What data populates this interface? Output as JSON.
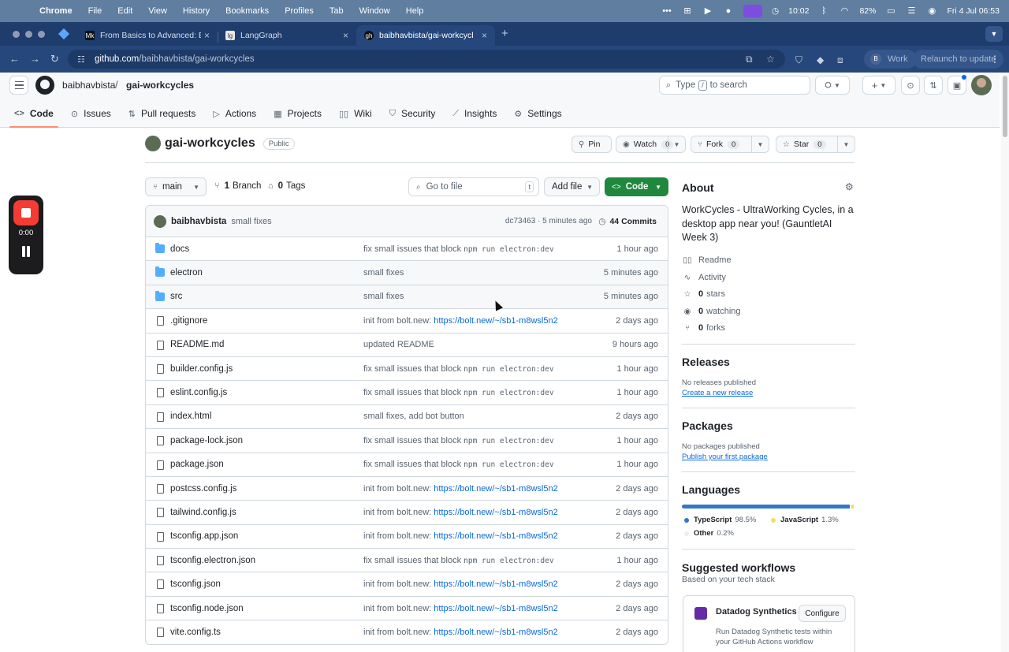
{
  "menubar": {
    "app": "Chrome",
    "items": [
      "File",
      "Edit",
      "View",
      "History",
      "Bookmarks",
      "Profiles",
      "Tab",
      "Window",
      "Help"
    ],
    "clock_timer": "10:02",
    "battery": "82%",
    "datetime": "Fri 4 Jul  06:53"
  },
  "browser": {
    "tabs": [
      {
        "title": "From Basics to Advanced: Ex",
        "favicon": "Mk"
      },
      {
        "title": "LangGraph",
        "favicon": "lg"
      },
      {
        "title": "baibhavbista/gai-workcycles",
        "favicon": "gh"
      }
    ],
    "url_host": "github.com",
    "url_path": "/baibhavbista/gai-workcycles",
    "profile_initial": "B",
    "profile_label": "Work",
    "relaunch_label": "Relaunch to update"
  },
  "header": {
    "owner": "baibhavbista",
    "separator": "/",
    "repo": "gai-workcycles",
    "search_prefix": "Type",
    "search_key": "/",
    "search_suffix": "to search"
  },
  "repo_nav": [
    {
      "label": "Code",
      "icon": "code-icon"
    },
    {
      "label": "Issues",
      "icon": "issue-icon"
    },
    {
      "label": "Pull requests",
      "icon": "pull-request-icon"
    },
    {
      "label": "Actions",
      "icon": "play-icon"
    },
    {
      "label": "Projects",
      "icon": "table-icon"
    },
    {
      "label": "Wiki",
      "icon": "book-icon"
    },
    {
      "label": "Security",
      "icon": "shield-icon"
    },
    {
      "label": "Insights",
      "icon": "graph-icon"
    },
    {
      "label": "Settings",
      "icon": "gear-icon"
    }
  ],
  "recorder": {
    "time": "0:00"
  },
  "repo": {
    "name": "gai-workcycles",
    "visibility": "Public",
    "pin_label": "Pin",
    "watch_label": "Watch",
    "watch_count": "0",
    "fork_label": "Fork",
    "fork_count": "0",
    "star_label": "Star",
    "star_count": "0"
  },
  "branch_bar": {
    "branch": "main",
    "branch_count": "1",
    "branch_word": "Branch",
    "tag_count": "0",
    "tag_word": "Tags",
    "goto_placeholder": "Go to file",
    "goto_key": "t",
    "add_file_label": "Add file",
    "code_label": "Code"
  },
  "latest_commit": {
    "author": "baibhavbista",
    "message": "small fixes",
    "hash_time": "dc73463 · 5 minutes ago",
    "commits_label": "44 Commits"
  },
  "files": [
    {
      "name": "docs",
      "type": "dir",
      "msg": "fix small issues that block ",
      "code": "npm run electron:dev",
      "link": "",
      "age": "1 hour ago"
    },
    {
      "name": "electron",
      "type": "dir",
      "msg": "small fixes",
      "code": "",
      "link": "",
      "age": "5 minutes ago"
    },
    {
      "name": "src",
      "type": "dir",
      "msg": "small fixes",
      "code": "",
      "link": "",
      "age": "5 minutes ago"
    },
    {
      "name": ".gitignore",
      "type": "file",
      "msg": "init from bolt.new: ",
      "code": "",
      "link": "https://bolt.new/~/sb1-m8wsl5n2",
      "age": "2 days ago"
    },
    {
      "name": "README.md",
      "type": "file",
      "msg": "updated README",
      "code": "",
      "link": "",
      "age": "9 hours ago"
    },
    {
      "name": "builder.config.js",
      "type": "file",
      "msg": "fix small issues that block ",
      "code": "npm run electron:dev",
      "link": "",
      "age": "1 hour ago"
    },
    {
      "name": "eslint.config.js",
      "type": "file",
      "msg": "fix small issues that block ",
      "code": "npm run electron:dev",
      "link": "",
      "age": "1 hour ago"
    },
    {
      "name": "index.html",
      "type": "file",
      "msg": "small fixes, add bot button",
      "code": "",
      "link": "",
      "age": "2 days ago"
    },
    {
      "name": "package-lock.json",
      "type": "file",
      "msg": "fix small issues that block ",
      "code": "npm run electron:dev",
      "link": "",
      "age": "1 hour ago"
    },
    {
      "name": "package.json",
      "type": "file",
      "msg": "fix small issues that block ",
      "code": "npm run electron:dev",
      "link": "",
      "age": "1 hour ago"
    },
    {
      "name": "postcss.config.js",
      "type": "file",
      "msg": "init from bolt.new: ",
      "code": "",
      "link": "https://bolt.new/~/sb1-m8wsl5n2",
      "age": "2 days ago"
    },
    {
      "name": "tailwind.config.js",
      "type": "file",
      "msg": "init from bolt.new: ",
      "code": "",
      "link": "https://bolt.new/~/sb1-m8wsl5n2",
      "age": "2 days ago"
    },
    {
      "name": "tsconfig.app.json",
      "type": "file",
      "msg": "init from bolt.new: ",
      "code": "",
      "link": "https://bolt.new/~/sb1-m8wsl5n2",
      "age": "2 days ago"
    },
    {
      "name": "tsconfig.electron.json",
      "type": "file",
      "msg": "fix small issues that block ",
      "code": "npm run electron:dev",
      "link": "",
      "age": "1 hour ago"
    },
    {
      "name": "tsconfig.json",
      "type": "file",
      "msg": "init from bolt.new: ",
      "code": "",
      "link": "https://bolt.new/~/sb1-m8wsl5n2",
      "age": "2 days ago"
    },
    {
      "name": "tsconfig.node.json",
      "type": "file",
      "msg": "init from bolt.new: ",
      "code": "",
      "link": "https://bolt.new/~/sb1-m8wsl5n2",
      "age": "2 days ago"
    },
    {
      "name": "vite.config.ts",
      "type": "file",
      "msg": "init from bolt.new: ",
      "code": "",
      "link": "https://bolt.new/~/sb1-m8wsl5n2",
      "age": "2 days ago"
    }
  ],
  "about": {
    "heading": "About",
    "description": "WorkCycles - UltraWorking Cycles, in a desktop app near you! (GauntletAI Week 3)",
    "readme": "Readme",
    "activity": "Activity",
    "stars_count": "0",
    "stars_word": "stars",
    "watching_count": "0",
    "watching_word": "watching",
    "forks_count": "0",
    "forks_word": "forks"
  },
  "releases": {
    "heading": "Releases",
    "none": "No releases published",
    "create": "Create a new release"
  },
  "packages": {
    "heading": "Packages",
    "none": "No packages published",
    "publish": "Publish your first package"
  },
  "languages": {
    "heading": "Languages",
    "items": [
      {
        "name": "TypeScript",
        "percent": "98.5%",
        "share": 98.5,
        "color": "#3178c6"
      },
      {
        "name": "JavaScript",
        "percent": "1.3%",
        "share": 1.3,
        "color": "#f1e05a"
      },
      {
        "name": "Other",
        "percent": "0.2%",
        "share": 0.2,
        "color": "#ededed"
      }
    ]
  },
  "workflows": {
    "heading": "Suggested workflows",
    "sub": "Based on your tech stack",
    "card_title": "Datadog Synthetics",
    "card_button": "Configure",
    "card_desc": "Run Datadog Synthetic tests within your GitHub Actions workflow"
  },
  "colors": {
    "accent_green": "#1f883d",
    "link_blue": "#0969da",
    "tab_underline": "#fd8c73",
    "chrome_frame": "#1e3c6c"
  }
}
